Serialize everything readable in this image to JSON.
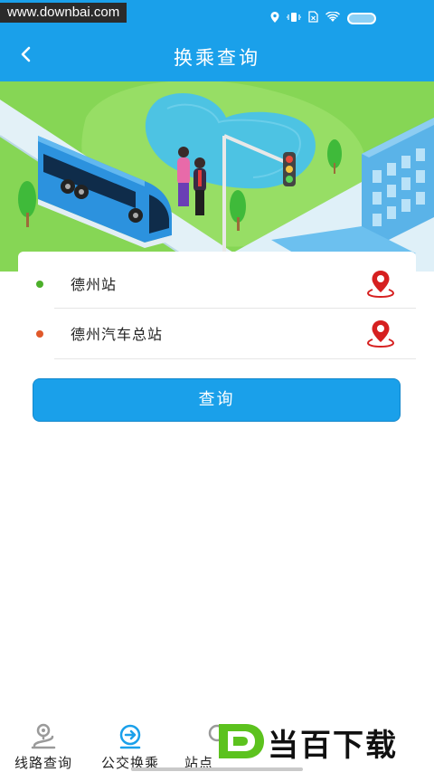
{
  "watermark": "www.downbai.com",
  "header": {
    "title": "换乘查询",
    "back_icon": "chevron-left-icon"
  },
  "colors": {
    "primary": "#1aa0ea",
    "start_dot": "#4caf2a",
    "end_dot": "#e0592a",
    "pin": "#d62020"
  },
  "route": {
    "start": "德州站",
    "end": "德州汽车总站"
  },
  "query_button": "查询",
  "bottom_nav": [
    {
      "label": "线路查询",
      "icon": "route-icon"
    },
    {
      "label": "公交换乘",
      "icon": "transfer-icon"
    },
    {
      "label": "站点",
      "icon": "station-icon"
    }
  ],
  "brand": {
    "name": "当百下载",
    "logo_letter": "D"
  }
}
